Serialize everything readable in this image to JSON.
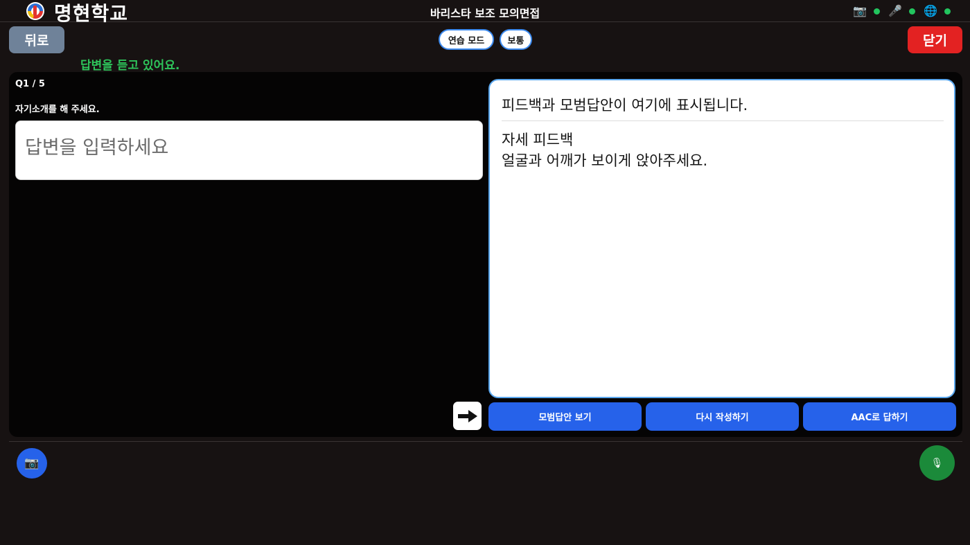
{
  "header": {
    "school_name": "명현학교",
    "title": "바리스타 보조 모의면접",
    "status": {
      "camera_icon": "📷",
      "mic_icon": "🎤",
      "globe_icon": "🌐",
      "dot_color": "#22c55e"
    }
  },
  "toolbar": {
    "back_label": "뒤로",
    "close_label": "닫기",
    "mode_label": "연습 모드",
    "level_label": "보통",
    "listening_text": "답변을 듣고 있어요."
  },
  "question": {
    "number": "Q1 / 5",
    "text": "자기소개를 해 주세요.",
    "answer_value": "",
    "answer_placeholder": "답변을 입력하세요"
  },
  "feedback": {
    "title": "피드백과 모범답안이 여기에 표시됩니다.",
    "detail_heading": "자세 피드백",
    "detail_text": "얼굴과 어깨가 보이게 앉아주세요."
  },
  "actions": {
    "model_answer_label": "모범답안 보기",
    "rewrite_label": "다시 작성하기",
    "aac_label": "AAC로 답하기"
  },
  "bottom": {
    "camera_icon": "📷",
    "mic_icon": "🎙"
  },
  "colors": {
    "accent": "#2662ea",
    "danger": "#e32222",
    "success": "#2ec55b"
  }
}
